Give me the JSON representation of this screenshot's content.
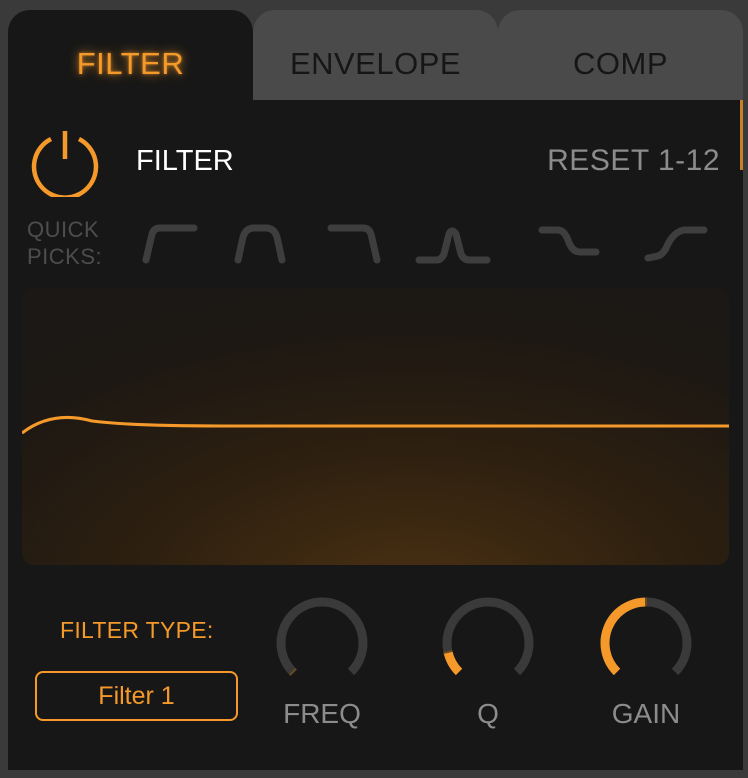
{
  "tabs": [
    {
      "label": "FILTER",
      "active": true
    },
    {
      "label": "ENVELOPE",
      "active": false
    },
    {
      "label": "COMP",
      "active": false
    }
  ],
  "header": {
    "title": "FILTER",
    "reset_label": "RESET 1-12",
    "power_icon": "power-icon",
    "power_on": true
  },
  "quick_picks": {
    "label_line1": "QUICK",
    "label_line2": "PICKS:",
    "shapes": [
      "high-pass-icon",
      "band-pass-icon",
      "low-pass-icon",
      "peak-icon",
      "low-shelf-icon",
      "high-shelf-icon"
    ]
  },
  "filter_type": {
    "label": "FILTER TYPE:",
    "value": "Filter 1"
  },
  "knobs": [
    {
      "label": "FREQ",
      "value": 0.0
    },
    {
      "label": "Q",
      "value": 0.12
    },
    {
      "label": "GAIN",
      "value": 0.5
    }
  ],
  "colors": {
    "accent": "#f59a2a",
    "panel": "#171717",
    "inactive_tab": "#4a4a4a",
    "muted_text": "#8c8c8c",
    "knob_track": "#3a3a3a"
  }
}
